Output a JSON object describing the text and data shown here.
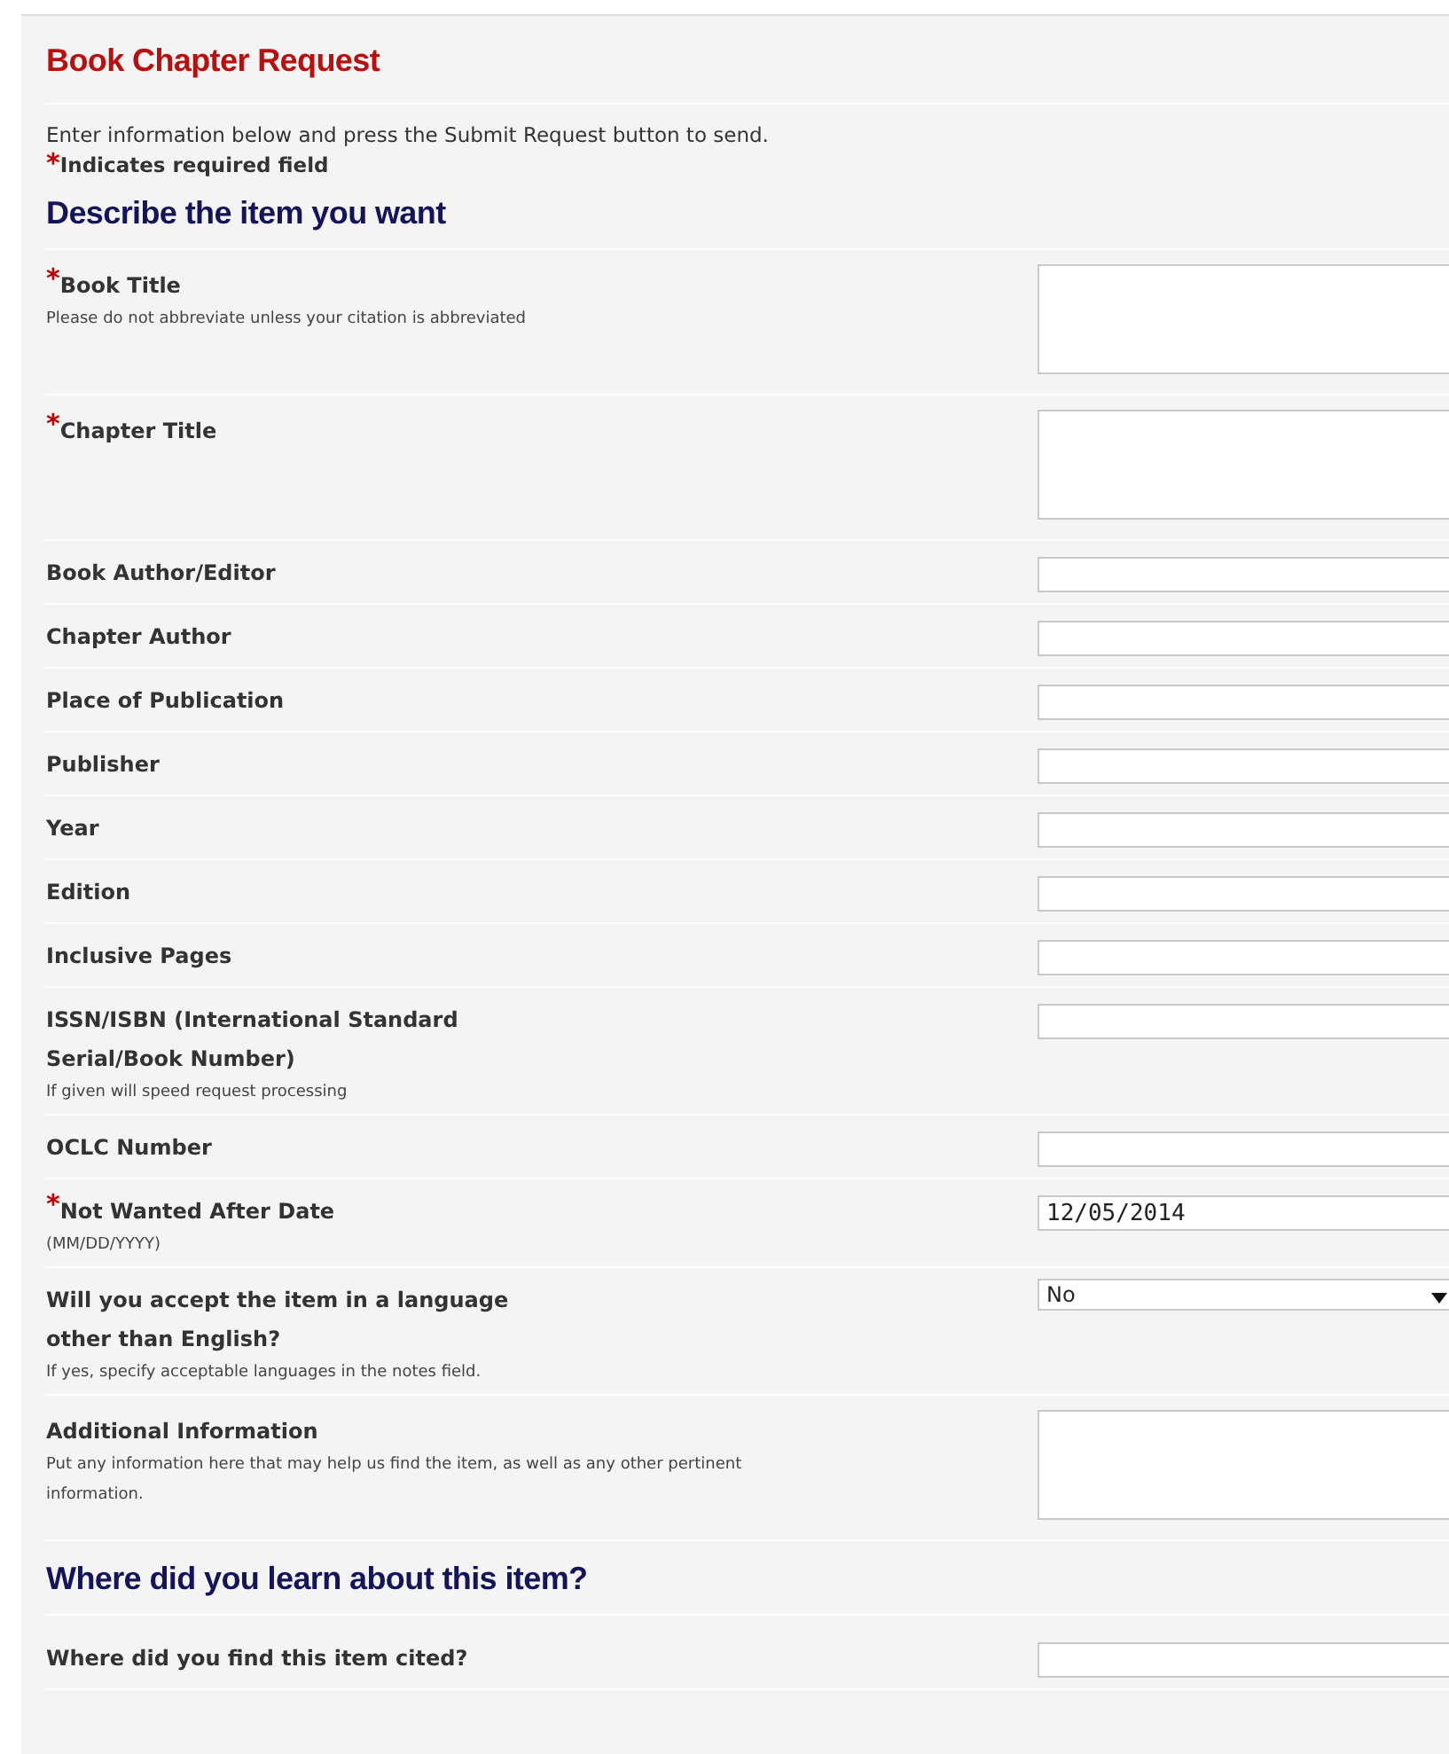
{
  "title": "Book Chapter Request",
  "intro": "Enter information below and press the Submit Request button to send.",
  "required_note": {
    "marker": "*",
    "text": "Indicates required field"
  },
  "sections": [
    {
      "heading": "Describe the item you want",
      "fields": [
        {
          "kind": "textarea",
          "label": "Book Title",
          "required": true,
          "hint": "Please do not abbreviate unless your citation is abbreviated"
        },
        {
          "kind": "textarea",
          "label": "Chapter Title",
          "required": true
        },
        {
          "kind": "input",
          "label": "Book Author/Editor",
          "required": false
        },
        {
          "kind": "input",
          "label": "Chapter Author",
          "required": false
        },
        {
          "kind": "input",
          "label": "Place of Publication",
          "required": false
        },
        {
          "kind": "input",
          "label": "Publisher",
          "required": false
        },
        {
          "kind": "input",
          "label": "Year",
          "required": false
        },
        {
          "kind": "input",
          "label": "Edition",
          "required": false
        },
        {
          "kind": "input",
          "label": "Inclusive Pages",
          "required": false
        },
        {
          "kind": "input",
          "label": "ISSN/ISBN (International Standard Serial/Book Number)",
          "required": false,
          "hint": "If given will speed request processing"
        },
        {
          "kind": "input",
          "label": "OCLC Number",
          "required": false
        },
        {
          "kind": "input",
          "label": "Not Wanted After Date",
          "required": true,
          "hint": "(MM/DD/YYYY)",
          "value": "12/05/2014"
        },
        {
          "kind": "select",
          "label": "Will you accept the item in a language other than English?",
          "required": false,
          "hint": "If yes, specify acceptable languages in the notes field.",
          "value": "No"
        },
        {
          "kind": "textarea",
          "label": "Additional Information",
          "required": false,
          "hint": "Put any information here that may help us find the item, as well as any other pertinent information."
        }
      ]
    },
    {
      "heading": "Where did you learn about this item?",
      "fields": [
        {
          "kind": "input",
          "label": "Where did you find this item cited?",
          "required": false
        }
      ]
    }
  ]
}
